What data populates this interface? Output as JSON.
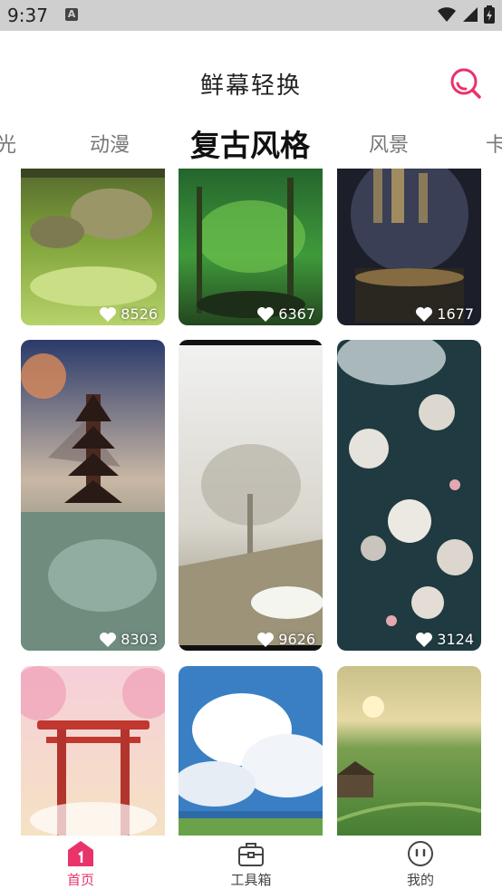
{
  "status_bar": {
    "time": "9:37",
    "notif_icon_letter": "A"
  },
  "header": {
    "title": "鲜幕轻换",
    "search_icon": "search-icon",
    "accent_color": "#e8336b"
  },
  "tabs": [
    {
      "label": "光",
      "active": false
    },
    {
      "label": "动漫",
      "active": false
    },
    {
      "label": "复古风格",
      "active": true
    },
    {
      "label": "风景",
      "active": false
    },
    {
      "label": "卡",
      "active": false
    }
  ],
  "wallpapers": [
    {
      "likes": "8526",
      "theme": "mossy-rocks"
    },
    {
      "likes": "6367",
      "theme": "green-forest"
    },
    {
      "likes": "1677",
      "theme": "crystal-city"
    },
    {
      "likes": "8303",
      "theme": "pagoda-lake"
    },
    {
      "likes": "9626",
      "theme": "misty-tree"
    },
    {
      "likes": "3124",
      "theme": "dark-flowers"
    },
    {
      "likes": "",
      "theme": "torii-gate"
    },
    {
      "likes": "",
      "theme": "cloudy-sky"
    },
    {
      "likes": "",
      "theme": "rice-fields"
    }
  ],
  "bottom_nav": [
    {
      "label": "首页",
      "icon": "home-icon",
      "active": true
    },
    {
      "label": "工具箱",
      "icon": "toolbox-icon",
      "active": false
    },
    {
      "label": "我的",
      "icon": "profile-icon",
      "active": false
    }
  ]
}
